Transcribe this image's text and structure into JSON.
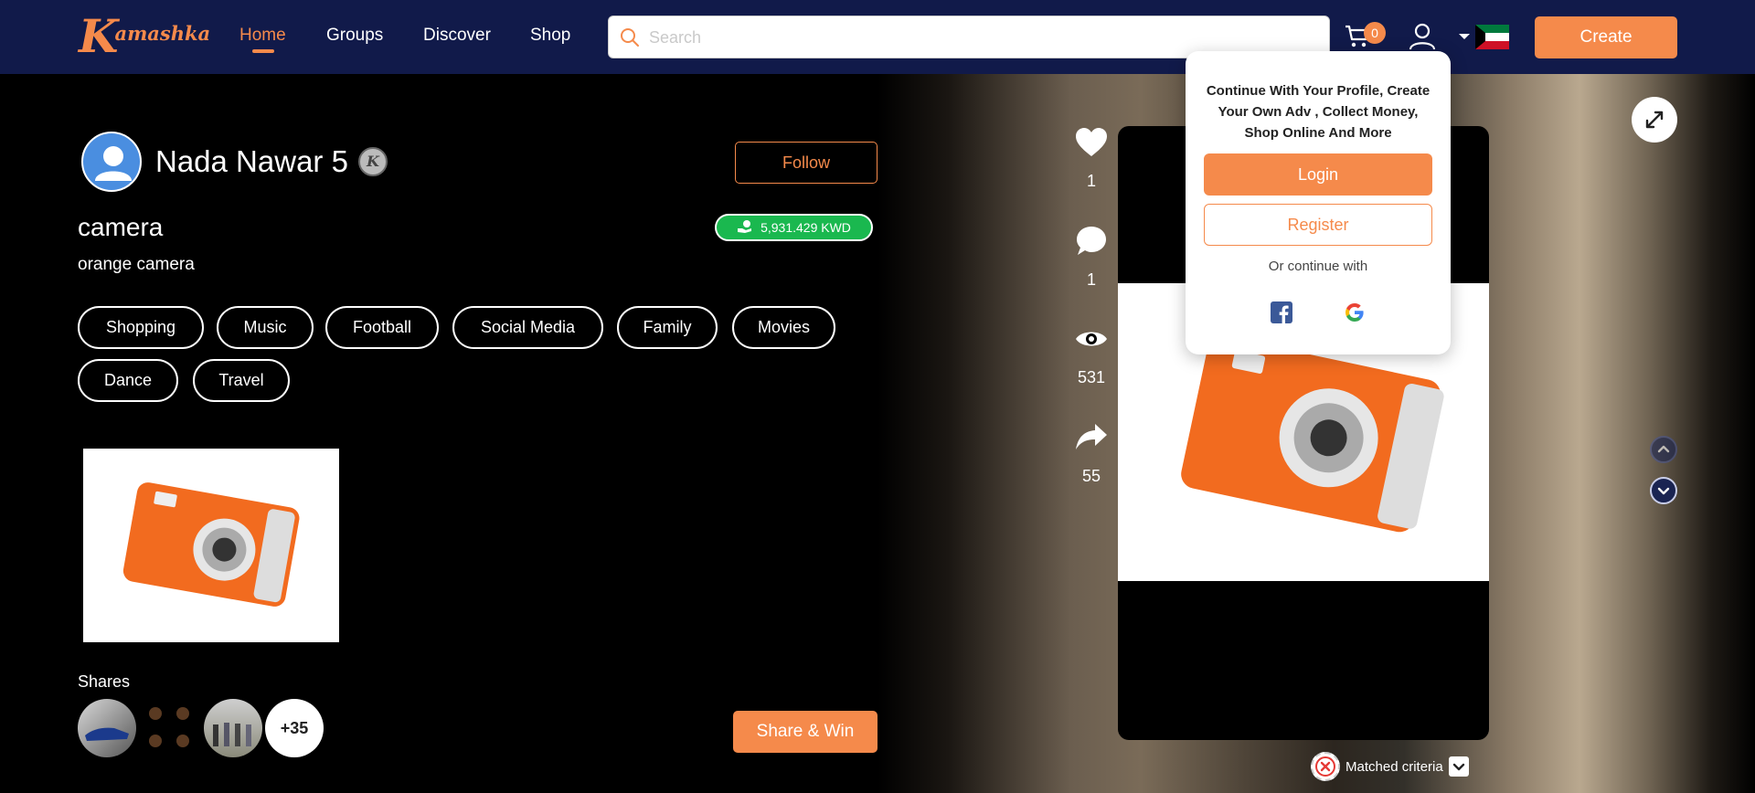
{
  "navbar": {
    "logo_k": "K",
    "logo_text": "amashka",
    "links": [
      "Home",
      "Groups",
      "Discover",
      "Shop"
    ],
    "active_link": "Home",
    "search_placeholder": "Search",
    "cart_count": "0",
    "create_label": "Create"
  },
  "profile": {
    "name": "Nada Nawar 5",
    "badge_letter": "K",
    "follow_label": "Follow"
  },
  "post": {
    "title": "camera",
    "price": "5,931.429 KWD",
    "description": "orange camera",
    "tags": [
      "Shopping",
      "Music",
      "Football",
      "Social Media",
      "Family",
      "Movies",
      "Dance",
      "Travel"
    ]
  },
  "shares": {
    "label": "Shares",
    "more_count": "+35",
    "share_win_label": "Share & Win"
  },
  "stats": {
    "likes": "1",
    "comments": "1",
    "views": "531",
    "shares": "55"
  },
  "popup": {
    "message": "Continue With Your Profile, Create Your Own Adv , Collect Money, Shop Online And More",
    "login_label": "Login",
    "register_label": "Register",
    "or_text": "Or continue with"
  },
  "matched_criteria_label": "Matched criteria",
  "colors": {
    "navbar_bg": "#111a4a",
    "accent": "#f58a4b",
    "price_green": "#1ab84f"
  }
}
